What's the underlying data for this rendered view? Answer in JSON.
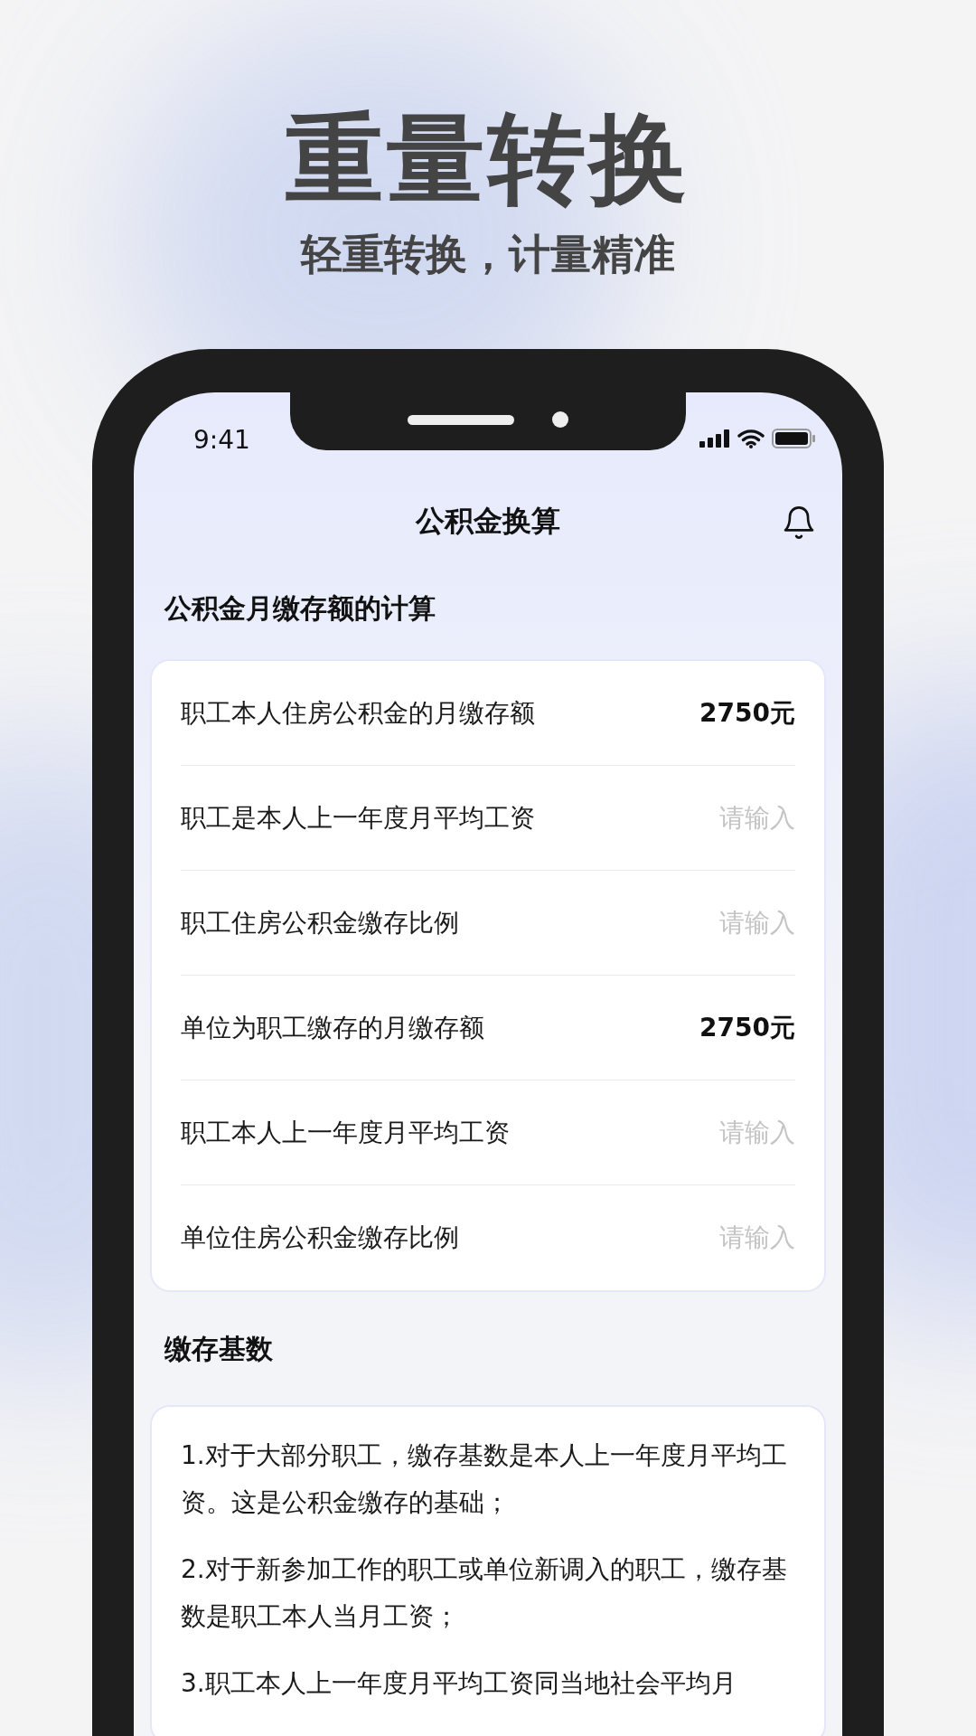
{
  "headline": "重量转换",
  "tagline": "轻重转换，计量精准",
  "status_bar": {
    "time": "9:41"
  },
  "nav": {
    "title": "公积金换算"
  },
  "calc_section": {
    "heading": "公积金月缴存额的计算",
    "rows": [
      {
        "kind": "value",
        "label": "职工本人住房公积金的月缴存额",
        "value": "2750元"
      },
      {
        "kind": "input",
        "label": "职工是本人上一年度月平均工资",
        "placeholder": "请输入"
      },
      {
        "kind": "input",
        "label": "职工住房公积金缴存比例",
        "placeholder": "请输入"
      },
      {
        "kind": "value",
        "label": "单位为职工缴存的月缴存额",
        "value": "2750元"
      },
      {
        "kind": "input",
        "label": "职工本人上一年度月平均工资",
        "placeholder": "请输入"
      },
      {
        "kind": "input",
        "label": "单位住房公积金缴存比例",
        "placeholder": "请输入"
      }
    ]
  },
  "base_section": {
    "heading": "缴存基数",
    "paragraphs": [
      "1.对于大部分职工，缴存基数是本人上一年度月平均工资。这是公积金缴存的基础；",
      "2.对于新参加工作的职工或单位新调入的职工，缴存基数是职工本人当月工资；",
      "3.职工本人上一年度月平均工资同当地社会平均月"
    ]
  }
}
